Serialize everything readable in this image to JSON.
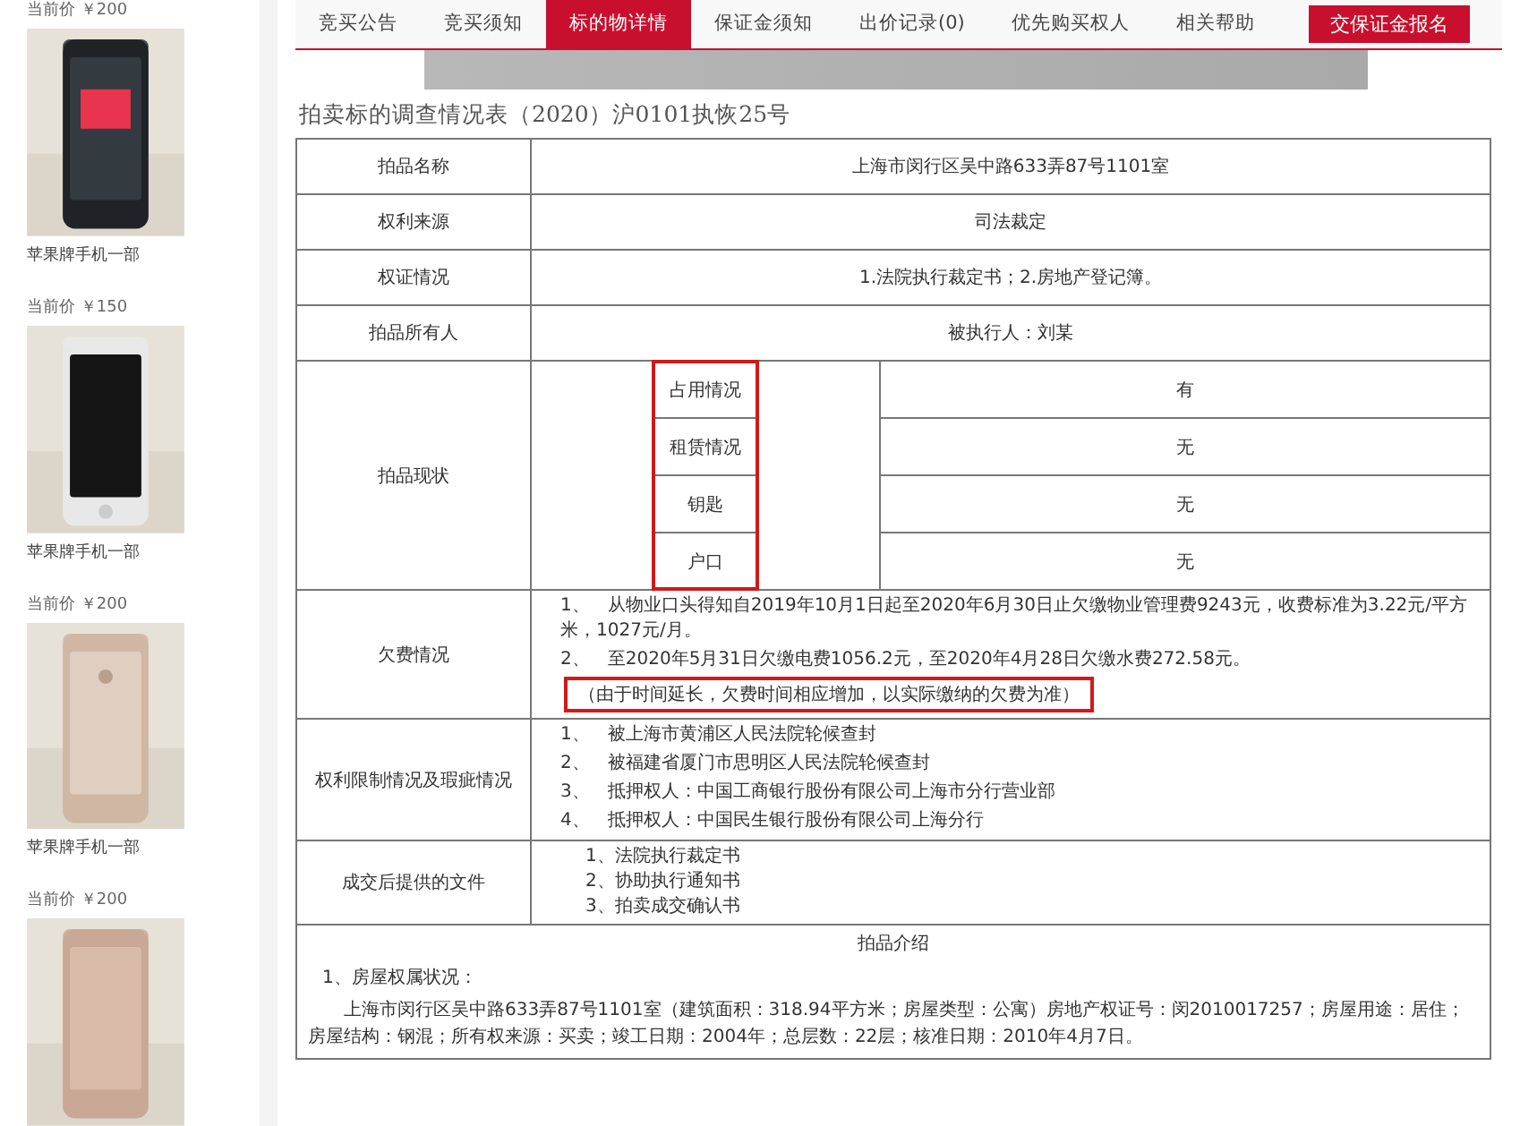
{
  "sidebar": {
    "items": [
      {
        "price": "当前价 ￥200",
        "title": "苹果牌手机一部"
      },
      {
        "price": "当前价 ￥150",
        "title": "苹果牌手机一部"
      },
      {
        "price": "当前价 ￥200",
        "title": "苹果牌手机一部"
      },
      {
        "price": "当前价 ￥200"
      }
    ]
  },
  "tabs": [
    {
      "label": "竞买公告",
      "selected": false
    },
    {
      "label": "竞买须知",
      "selected": false
    },
    {
      "label": "标的物详情",
      "selected": true
    },
    {
      "label": "保证金须知",
      "selected": false
    },
    {
      "label": "出价记录(0)",
      "selected": false
    },
    {
      "label": "优先购买权人",
      "selected": false
    },
    {
      "label": "相关帮助",
      "selected": false
    }
  ],
  "register_button": "交保证金报名",
  "title": "拍卖标的调查情况表（2020）沪0101执恢25号",
  "table": {
    "rows": [
      {
        "kind": "text",
        "label": "拍品名称",
        "value": "上海市闵行区吴中路633弄87号1101室"
      },
      {
        "kind": "text",
        "label": "权利来源",
        "value": "司法裁定"
      },
      {
        "kind": "text",
        "label": "权证情况",
        "value": "1.法院执行裁定书；2.房地产登记簿。"
      },
      {
        "kind": "text",
        "label": "拍品所有人",
        "value": "被执行人：刘某"
      },
      {
        "kind": "status",
        "label": "拍品现状",
        "highlighted": true,
        "items": [
          {
            "label": "占用情况",
            "value": "有"
          },
          {
            "label": "租赁情况",
            "value": "无"
          },
          {
            "label": "钥匙",
            "value": "无"
          },
          {
            "label": "户口",
            "value": "无"
          }
        ]
      },
      {
        "kind": "list",
        "label": "欠费情况",
        "lines": [
          {
            "number": "1、",
            "text": "从物业口头得知自2019年10月1日起至2020年6月30日止欠缴物业管理费9243元，收费标准为3.22元/平方米，1027元/月。"
          },
          {
            "number": "2、",
            "text": "至2020年5月31日欠缴电费1056.2元，至2020年4月28日欠缴水费272.58元。"
          }
        ],
        "note": {
          "text": "（由于时间延长，欠费时间相应增加，以实际缴纳的欠费为准）",
          "highlighted": true
        }
      },
      {
        "kind": "list",
        "label": "权利限制情况及瑕疵情况",
        "lines": [
          {
            "number": "1、",
            "text": "被上海市黄浦区人民法院轮候查封"
          },
          {
            "number": "2、",
            "text": "被福建省厦门市思明区人民法院轮候查封"
          },
          {
            "number": "3、",
            "text": "抵押权人：中国工商银行股份有限公司上海市分行营业部"
          },
          {
            "number": "4、",
            "text": "抵押权人：中国民生银行股份有限公司上海分行"
          }
        ]
      },
      {
        "kind": "docs",
        "label": "成交后提供的文件",
        "docs": [
          "1、法院执行裁定书",
          "2、协助执行通知书",
          "3、拍卖成交确认书"
        ]
      }
    ]
  },
  "intro": {
    "heading": "拍品介绍",
    "subheading": "1、房屋权属状况：",
    "paragraph": "上海市闵行区吴中路633弄87号1101室（建筑面积：318.94平方米；房屋类型：公寓）房地产权证号：闵2010017257；房屋用途：居住；房屋结构：钢混；所有权来源：买卖；竣工日期：2004年；总层数：22层；核准日期：2010年4月7日。"
  }
}
